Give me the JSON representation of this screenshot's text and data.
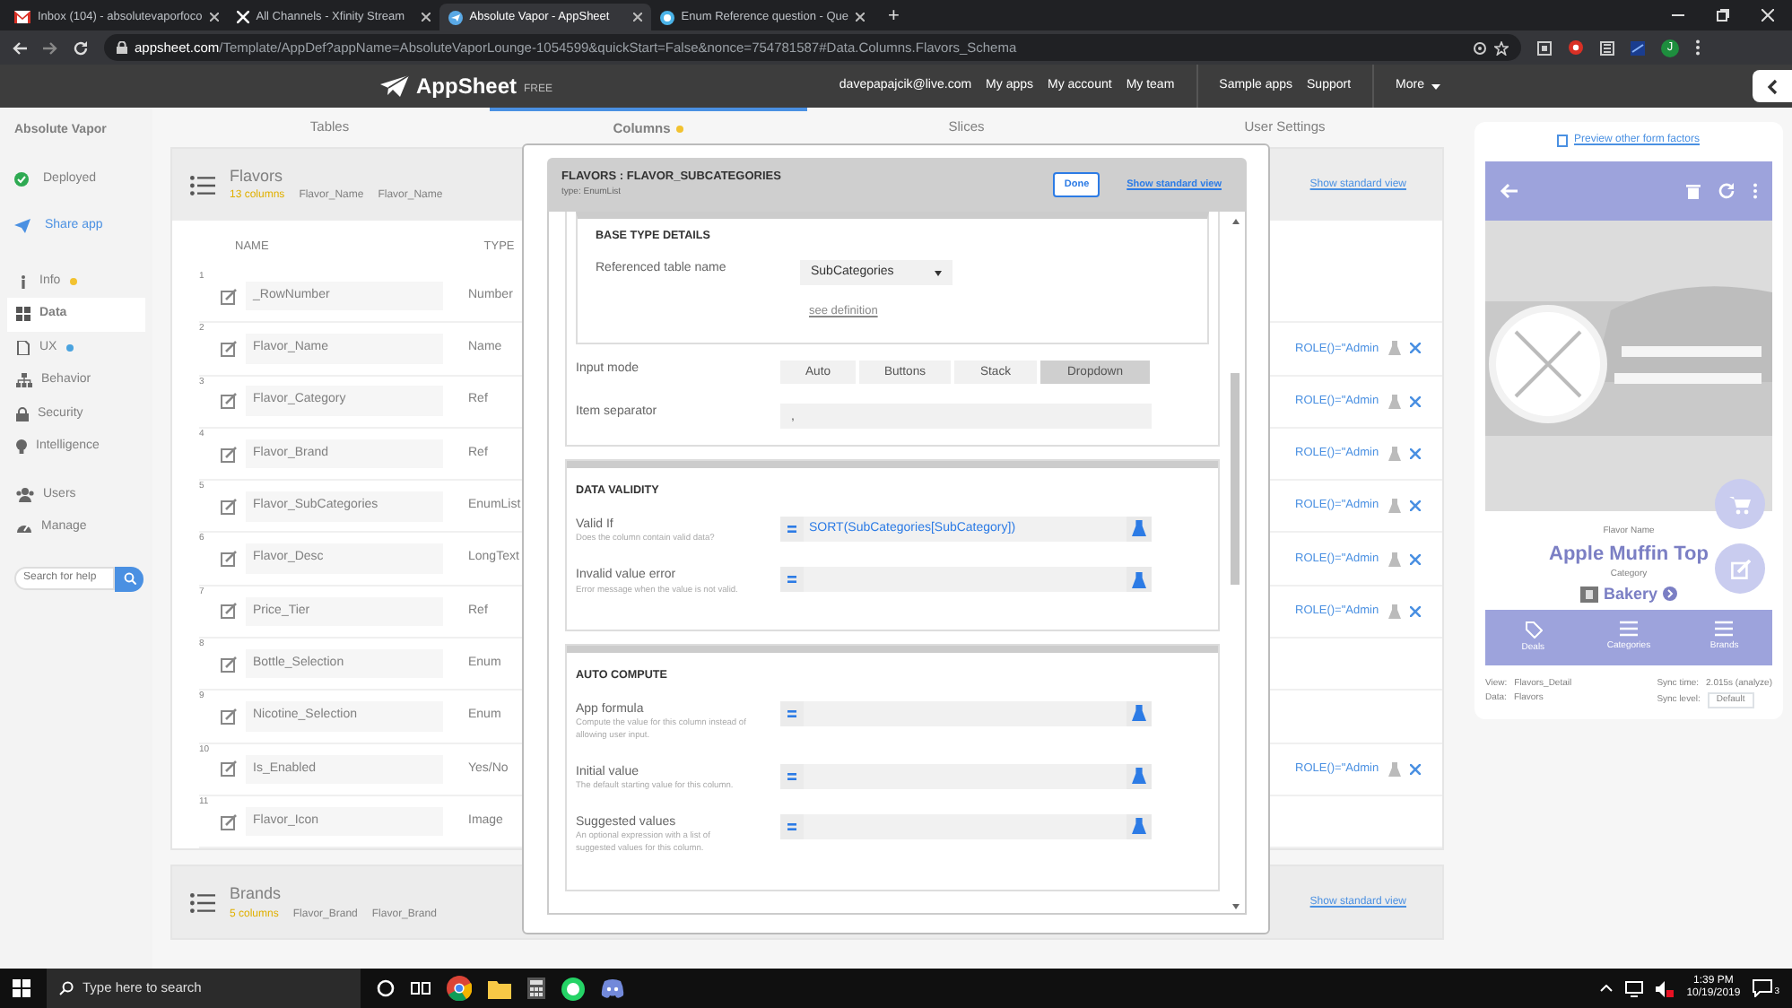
{
  "browser": {
    "tabs": [
      {
        "title": "Inbox (104) - absolutevaporfoco",
        "selected": false
      },
      {
        "title": "All Channels - Xfinity Stream",
        "selected": false
      },
      {
        "title": "Absolute Vapor - AppSheet",
        "selected": true
      },
      {
        "title": "Enum Reference question - Que",
        "selected": false
      }
    ],
    "new_tab": "+",
    "url_host": "appsheet.com",
    "url_path": "/Template/AppDef?appName=AbsoluteVaporLounge-1054599&quickStart=False&nonce=754781587#Data.Columns.Flavors_Schema",
    "profile_initial": "J"
  },
  "header": {
    "logo": "AppSheet",
    "plan": "FREE",
    "email": "davepapajcik@live.com",
    "links": [
      "My apps",
      "My account",
      "My team"
    ],
    "links_2": [
      "Sample apps",
      "Support"
    ],
    "more": "More"
  },
  "sidebar": {
    "app_name": "Absolute Vapor",
    "status": "Deployed",
    "share": "Share app",
    "items": [
      {
        "label": "Info",
        "selected": false,
        "color": "#f2c230"
      },
      {
        "label": "Data",
        "selected": true
      },
      {
        "label": "UX",
        "selected": false,
        "color": "#4aa3df"
      },
      {
        "label": "Behavior",
        "selected": false
      },
      {
        "label": "Security",
        "selected": false
      },
      {
        "label": "Intelligence",
        "selected": false
      }
    ],
    "items_2": [
      {
        "label": "Users",
        "selected": false
      },
      {
        "label": "Manage",
        "selected": false
      }
    ],
    "search_placeholder": "Search for help"
  },
  "data_tabs": [
    {
      "label": "Tables",
      "selected": false
    },
    {
      "label": "Columns",
      "selected": true
    },
    {
      "label": "Slices",
      "selected": false
    },
    {
      "label": "User Settings",
      "selected": false
    }
  ],
  "tables": [
    {
      "name": "Flavors",
      "summary": "13 columns",
      "key": "Flavor_Name",
      "label": "Flavor_Name",
      "standard_view": "Show standard view",
      "column_heads": [
        "NAME",
        "TYPE"
      ],
      "rows": [
        {
          "number": "1",
          "name": "_RowNumber",
          "type": "Number"
        },
        {
          "number": "2",
          "name": "Flavor_Name",
          "type": "Name",
          "formula": "ROLE()=\"Admin"
        },
        {
          "number": "3",
          "name": "Flavor_Category",
          "type": "Ref",
          "formula": "ROLE()=\"Admin"
        },
        {
          "number": "4",
          "name": "Flavor_Brand",
          "type": "Ref",
          "formula": "ROLE()=\"Admin"
        },
        {
          "number": "5",
          "name": "Flavor_SubCategories",
          "type": "EnumList",
          "formula": "ROLE()=\"Admin"
        },
        {
          "number": "6",
          "name": "Flavor_Desc",
          "type": "LongText",
          "formula": "ROLE()=\"Admin"
        },
        {
          "number": "7",
          "name": "Price_Tier",
          "type": "Ref",
          "formula": "ROLE()=\"Admin"
        },
        {
          "number": "8",
          "name": "Bottle_Selection",
          "type": "Enum"
        },
        {
          "number": "9",
          "name": "Nicotine_Selection",
          "type": "Enum"
        },
        {
          "number": "10",
          "name": "Is_Enabled",
          "type": "Yes/No",
          "formula": "ROLE()=\"Admin"
        },
        {
          "number": "11",
          "name": "Flavor_Icon",
          "type": "Image"
        }
      ]
    },
    {
      "name": "Brands",
      "summary": "5 columns",
      "key": "Flavor_Brand",
      "label": "Flavor_Brand",
      "standard_view": "Show standard view"
    }
  ],
  "preview": {
    "form_factors": "Preview other form factors",
    "field_label": "Flavor Name",
    "title": "Apple Muffin Top",
    "category_label": "Category",
    "category": "Bakery",
    "nav": [
      {
        "label": "Deals"
      },
      {
        "label": "Categories"
      },
      {
        "label": "Brands"
      }
    ],
    "view_label": "View:",
    "view": "Flavors_Detail",
    "data_label": "Data:",
    "data": "Flavors",
    "sync_time_label": "Sync time:",
    "sync_time": "2.015s (analyze)",
    "sync_level_label": "Sync level:",
    "sync_level": "Default"
  },
  "modal": {
    "title": "FLAVORS : FLAVOR_SUBCATEGORIES",
    "subtitle": "type: EnumList",
    "done": "Done",
    "standard_view": "Show standard view",
    "base_type": {
      "title": "BASE TYPE DETAILS",
      "label": "Referenced table name",
      "value": "SubCategories",
      "link": "see definition"
    },
    "input_mode": {
      "label": "Input mode",
      "options": [
        {
          "label": "Auto",
          "selected": false
        },
        {
          "label": "Buttons",
          "selected": false
        },
        {
          "label": "Stack",
          "selected": false
        },
        {
          "label": "Dropdown",
          "selected": true
        }
      ]
    },
    "item_separator": {
      "label": "Item separator",
      "value": ","
    },
    "sections": [
      {
        "title": "DATA VALIDITY",
        "fields": [
          {
            "label": "Valid If",
            "help": "Does the column contain valid data?",
            "value": "SORT(SubCategories[SubCategory])"
          },
          {
            "label": "Invalid value error",
            "help": "Error message when the value is not valid."
          }
        ]
      },
      {
        "title": "AUTO COMPUTE",
        "fields": [
          {
            "label": "App formula",
            "help": "Compute the value for this column instead of allowing user input."
          },
          {
            "label": "Initial value",
            "help": "The default starting value for this column."
          },
          {
            "label": "Suggested values",
            "help": "An optional expression with a list of suggested values for this column."
          }
        ]
      }
    ]
  },
  "taskbar": {
    "search_placeholder": "Type here to search",
    "time": "1:39 PM",
    "date": "10/19/2019",
    "notifications": "3"
  }
}
